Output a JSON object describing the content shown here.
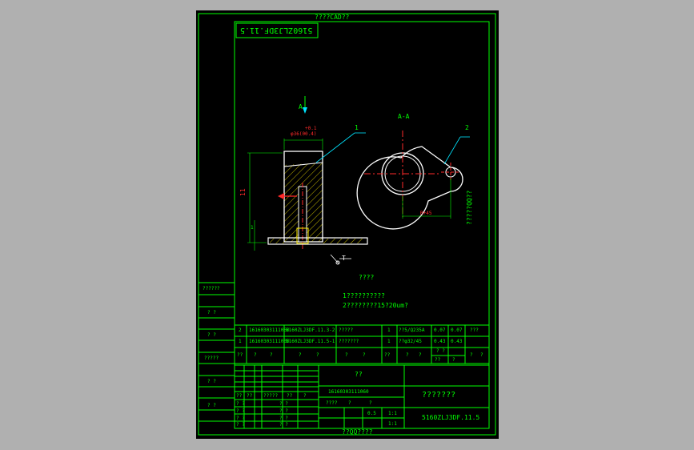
{
  "sheet": {
    "top_caption": "????CAD??",
    "bottom_caption": "??QQ????",
    "side_caption": "?????QQ??",
    "mirror_code": "5160ZLJ3DF.11.5"
  },
  "drawing": {
    "view_a_arrow": "A",
    "view_aa": "A-A",
    "balloon_1": "1",
    "balloon_2": "2",
    "tol_top": "+0.1",
    "tol_label": "φ36(00.4)",
    "dim_height": "11",
    "dim_small": "1",
    "dim_center": "R+45",
    "surface_mark": "T"
  },
  "notes": {
    "heading": "????",
    "line1": "1??????????",
    "line2": "2????????15?20um?"
  },
  "bom": {
    "rows": [
      {
        "no": "2",
        "code": "16160303111060",
        "drawing": "5160ZLJ3DF.11.3-2",
        "name": "?????",
        "qty": "1",
        "material": "??5/Q235A",
        "w1": "0.07",
        "w2": "0.07",
        "note": "???"
      },
      {
        "no": "1",
        "code": "16160303111080",
        "drawing": "5160ZLJ3DF.11.5-1",
        "name": "???????",
        "qty": "1",
        "material": "??φ32/45",
        "w1": "0.43",
        "w2": "0.43",
        "note": ""
      }
    ],
    "header": {
      "no": "??",
      "code": "?",
      "drawing": "?",
      "name": "?",
      "qty": "??",
      "material": "?",
      "w_head": "? ?",
      "w_sub1": "??",
      "w_sub2": "?",
      "note": "?"
    }
  },
  "left_column": [
    "??????",
    "? ?",
    "? ?",
    "?????",
    "? ?",
    "? ?"
  ],
  "title_block": {
    "project": "??",
    "code": "16160303111060",
    "name": "???????",
    "drawing_no": "5160ZLJ3DF.11.5",
    "sign_row": [
      "??",
      "??",
      "?????",
      "??",
      "?"
    ],
    "mini_rows": [
      "? ?",
      "? ?",
      "? ?",
      "? ?"
    ],
    "stage": "????",
    "scale_left": "?",
    "scale_mid": "?",
    "scale": "1:1",
    "weight": "0.5",
    "sheets": "1:1"
  },
  "colors": {
    "line": "#00ff00",
    "part": "#ffffff",
    "center": "#ff2a2a",
    "hatch": "#ffee00",
    "leader": "#00e5ff"
  }
}
